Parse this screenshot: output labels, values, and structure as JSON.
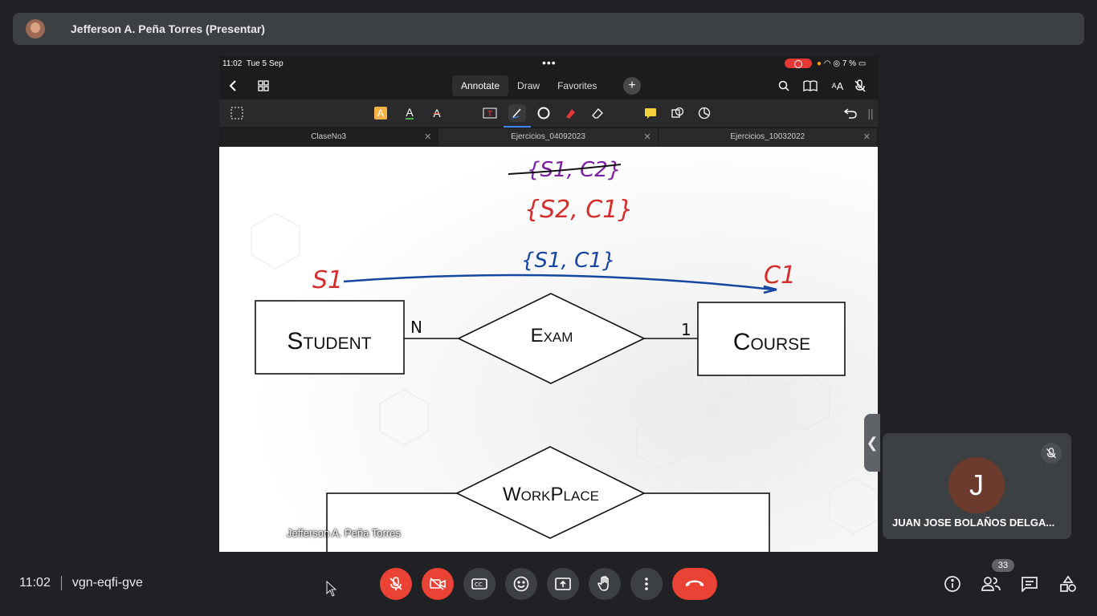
{
  "presenter_bar": {
    "title": "Jefferson A. Peña Torres (Presentar)"
  },
  "ipad": {
    "status": {
      "time": "11:02",
      "date": "Tue 5 Sep",
      "battery": "7 %"
    },
    "modes": [
      "Annotate",
      "Draw",
      "Favorites"
    ],
    "active_mode": "Annotate",
    "doc_tabs": [
      {
        "label": "ClaseNo3",
        "active": true
      },
      {
        "label": "Ejercicios_04092023",
        "active": false
      },
      {
        "label": "Ejercicios_10032022",
        "active": false
      }
    ],
    "diagram": {
      "entities": [
        "Student",
        "Course"
      ],
      "relationships": [
        "Exam",
        "WorkPlace"
      ],
      "cardinality_left": "N",
      "cardinality_right": "1",
      "handwriting": {
        "crossed_out": "{S1, C2}",
        "red_set": "{S2, C1}",
        "blue_set": "{S1, C1}",
        "left_label": "S1",
        "right_label": "C1"
      }
    },
    "presenter_label": "Jefferson A. Peña Torres"
  },
  "participant_tile": {
    "initial": "J",
    "name": "JUAN JOSE BOLAÑOS DELGA..."
  },
  "meeting": {
    "time": "11:02",
    "code": "vgn-eqfi-gve",
    "participant_count": "33"
  },
  "colors": {
    "red": "#ea4335",
    "ink_red": "#d32f2f",
    "ink_blue": "#1546a0",
    "ink_purple": "#7b1fa2"
  }
}
